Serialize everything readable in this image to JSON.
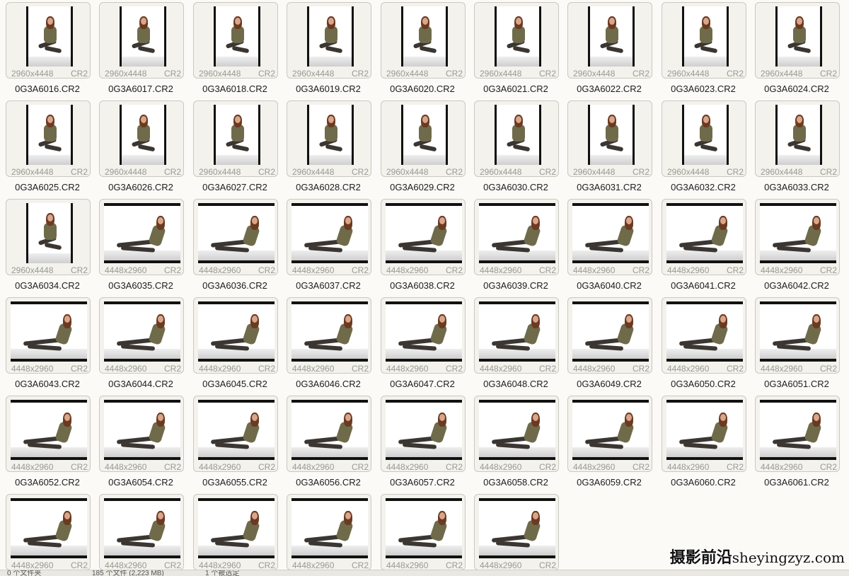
{
  "files": [
    {
      "name": "0G3A6016.CR2",
      "dims": "2960x4448",
      "format": "CR2",
      "orientation": "portrait"
    },
    {
      "name": "0G3A6017.CR2",
      "dims": "2960x4448",
      "format": "CR2",
      "orientation": "portrait"
    },
    {
      "name": "0G3A6018.CR2",
      "dims": "2960x4448",
      "format": "CR2",
      "orientation": "portrait"
    },
    {
      "name": "0G3A6019.CR2",
      "dims": "2960x4448",
      "format": "CR2",
      "orientation": "portrait"
    },
    {
      "name": "0G3A6020.CR2",
      "dims": "2960x4448",
      "format": "CR2",
      "orientation": "portrait"
    },
    {
      "name": "0G3A6021.CR2",
      "dims": "2960x4448",
      "format": "CR2",
      "orientation": "portrait"
    },
    {
      "name": "0G3A6022.CR2",
      "dims": "2960x4448",
      "format": "CR2",
      "orientation": "portrait"
    },
    {
      "name": "0G3A6023.CR2",
      "dims": "2960x4448",
      "format": "CR2",
      "orientation": "portrait"
    },
    {
      "name": "0G3A6024.CR2",
      "dims": "2960x4448",
      "format": "CR2",
      "orientation": "portrait"
    },
    {
      "name": "0G3A6025.CR2",
      "dims": "2960x4448",
      "format": "CR2",
      "orientation": "portrait"
    },
    {
      "name": "0G3A6026.CR2",
      "dims": "2960x4448",
      "format": "CR2",
      "orientation": "portrait"
    },
    {
      "name": "0G3A6027.CR2",
      "dims": "2960x4448",
      "format": "CR2",
      "orientation": "portrait"
    },
    {
      "name": "0G3A6028.CR2",
      "dims": "2960x4448",
      "format": "CR2",
      "orientation": "portrait"
    },
    {
      "name": "0G3A6029.CR2",
      "dims": "2960x4448",
      "format": "CR2",
      "orientation": "portrait"
    },
    {
      "name": "0G3A6030.CR2",
      "dims": "2960x4448",
      "format": "CR2",
      "orientation": "portrait"
    },
    {
      "name": "0G3A6031.CR2",
      "dims": "2960x4448",
      "format": "CR2",
      "orientation": "portrait"
    },
    {
      "name": "0G3A6032.CR2",
      "dims": "2960x4448",
      "format": "CR2",
      "orientation": "portrait"
    },
    {
      "name": "0G3A6033.CR2",
      "dims": "2960x4448",
      "format": "CR2",
      "orientation": "portrait"
    },
    {
      "name": "0G3A6034.CR2",
      "dims": "2960x4448",
      "format": "CR2",
      "orientation": "portrait"
    },
    {
      "name": "0G3A6035.CR2",
      "dims": "4448x2960",
      "format": "CR2",
      "orientation": "landscape"
    },
    {
      "name": "0G3A6036.CR2",
      "dims": "4448x2960",
      "format": "CR2",
      "orientation": "landscape"
    },
    {
      "name": "0G3A6037.CR2",
      "dims": "4448x2960",
      "format": "CR2",
      "orientation": "landscape"
    },
    {
      "name": "0G3A6038.CR2",
      "dims": "4448x2960",
      "format": "CR2",
      "orientation": "landscape"
    },
    {
      "name": "0G3A6039.CR2",
      "dims": "4448x2960",
      "format": "CR2",
      "orientation": "landscape"
    },
    {
      "name": "0G3A6040.CR2",
      "dims": "4448x2960",
      "format": "CR2",
      "orientation": "landscape"
    },
    {
      "name": "0G3A6041.CR2",
      "dims": "4448x2960",
      "format": "CR2",
      "orientation": "landscape"
    },
    {
      "name": "0G3A6042.CR2",
      "dims": "4448x2960",
      "format": "CR2",
      "orientation": "landscape"
    },
    {
      "name": "0G3A6043.CR2",
      "dims": "4448x2960",
      "format": "CR2",
      "orientation": "landscape"
    },
    {
      "name": "0G3A6044.CR2",
      "dims": "4448x2960",
      "format": "CR2",
      "orientation": "landscape"
    },
    {
      "name": "0G3A6045.CR2",
      "dims": "4448x2960",
      "format": "CR2",
      "orientation": "landscape"
    },
    {
      "name": "0G3A6046.CR2",
      "dims": "4448x2960",
      "format": "CR2",
      "orientation": "landscape"
    },
    {
      "name": "0G3A6047.CR2",
      "dims": "4448x2960",
      "format": "CR2",
      "orientation": "landscape"
    },
    {
      "name": "0G3A6048.CR2",
      "dims": "4448x2960",
      "format": "CR2",
      "orientation": "landscape"
    },
    {
      "name": "0G3A6049.CR2",
      "dims": "4448x2960",
      "format": "CR2",
      "orientation": "landscape"
    },
    {
      "name": "0G3A6050.CR2",
      "dims": "4448x2960",
      "format": "CR2",
      "orientation": "landscape"
    },
    {
      "name": "0G3A6051.CR2",
      "dims": "4448x2960",
      "format": "CR2",
      "orientation": "landscape"
    },
    {
      "name": "0G3A6052.CR2",
      "dims": "4448x2960",
      "format": "CR2",
      "orientation": "landscape"
    },
    {
      "name": "0G3A6054.CR2",
      "dims": "4448x2960",
      "format": "CR2",
      "orientation": "landscape"
    },
    {
      "name": "0G3A6055.CR2",
      "dims": "4448x2960",
      "format": "CR2",
      "orientation": "landscape"
    },
    {
      "name": "0G3A6056.CR2",
      "dims": "4448x2960",
      "format": "CR2",
      "orientation": "landscape"
    },
    {
      "name": "0G3A6057.CR2",
      "dims": "4448x2960",
      "format": "CR2",
      "orientation": "landscape"
    },
    {
      "name": "0G3A6058.CR2",
      "dims": "4448x2960",
      "format": "CR2",
      "orientation": "landscape"
    },
    {
      "name": "0G3A6059.CR2",
      "dims": "4448x2960",
      "format": "CR2",
      "orientation": "landscape"
    },
    {
      "name": "0G3A6060.CR2",
      "dims": "4448x2960",
      "format": "CR2",
      "orientation": "landscape"
    },
    {
      "name": "0G3A6061.CR2",
      "dims": "4448x2960",
      "format": "CR2",
      "orientation": "landscape"
    },
    {
      "name": "",
      "dims": "4448x2960",
      "format": "CR2",
      "orientation": "landscape"
    },
    {
      "name": "",
      "dims": "4448x2960",
      "format": "CR2",
      "orientation": "landscape"
    },
    {
      "name": "",
      "dims": "4448x2960",
      "format": "CR2",
      "orientation": "landscape"
    },
    {
      "name": "",
      "dims": "4448x2960",
      "format": "CR2",
      "orientation": "landscape"
    },
    {
      "name": "",
      "dims": "4448x2960",
      "format": "CR2",
      "orientation": "landscape"
    },
    {
      "name": "",
      "dims": "4448x2960",
      "format": "CR2",
      "orientation": "landscape"
    }
  ],
  "statusbar": {
    "left": "0 个文件夹",
    "middle": "185 个文件 (2,223 MB)",
    "right": "1 个被选定"
  },
  "watermark": {
    "cn": "摄影前沿",
    "domain": "sheyingzyz.com"
  },
  "colors": {
    "card_bg": "#f3f2ec",
    "card_border": "#c9c8c0",
    "meta_text": "#9a9a94"
  }
}
